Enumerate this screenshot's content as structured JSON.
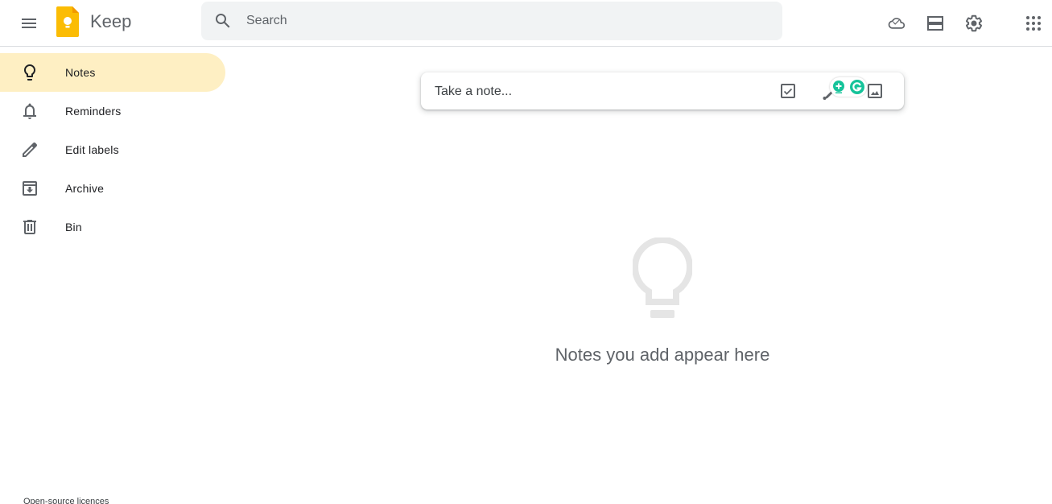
{
  "header": {
    "app_title": "Keep",
    "menu_icon": "hamburger-menu-icon",
    "logo_icon": "keep-logo-icon",
    "search": {
      "placeholder": "Search",
      "value": "",
      "icon": "search-icon"
    },
    "actions": [
      {
        "name": "refresh",
        "icon": "cloud-check-icon"
      },
      {
        "name": "list-view",
        "icon": "list-view-icon"
      },
      {
        "name": "settings",
        "icon": "gear-icon"
      },
      {
        "name": "apps",
        "icon": "apps-grid-icon"
      }
    ]
  },
  "sidebar": {
    "items": [
      {
        "label": "Notes",
        "icon": "lightbulb-icon",
        "active": true
      },
      {
        "label": "Reminders",
        "icon": "bell-icon",
        "active": false
      },
      {
        "label": "Edit labels",
        "icon": "pencil-icon",
        "active": false
      },
      {
        "label": "Archive",
        "icon": "archive-icon",
        "active": false
      },
      {
        "label": "Bin",
        "icon": "trash-icon",
        "active": false
      }
    ],
    "footer_link": "Open-source licences"
  },
  "take_note": {
    "placeholder": "Take a note...",
    "actions": [
      {
        "name": "new-list",
        "icon": "checkbox-icon"
      },
      {
        "name": "new-drawing",
        "icon": "brush-icon"
      },
      {
        "name": "new-image",
        "icon": "image-icon"
      }
    ],
    "extension_icon": "grammarly-icon"
  },
  "empty_state": {
    "icon": "lightbulb-icon",
    "message": "Notes you add appear here"
  },
  "colors": {
    "accent": "#feefc3",
    "logo": "#fbbc04",
    "grammarly": "#15c39a",
    "icon": "#5f6368"
  }
}
